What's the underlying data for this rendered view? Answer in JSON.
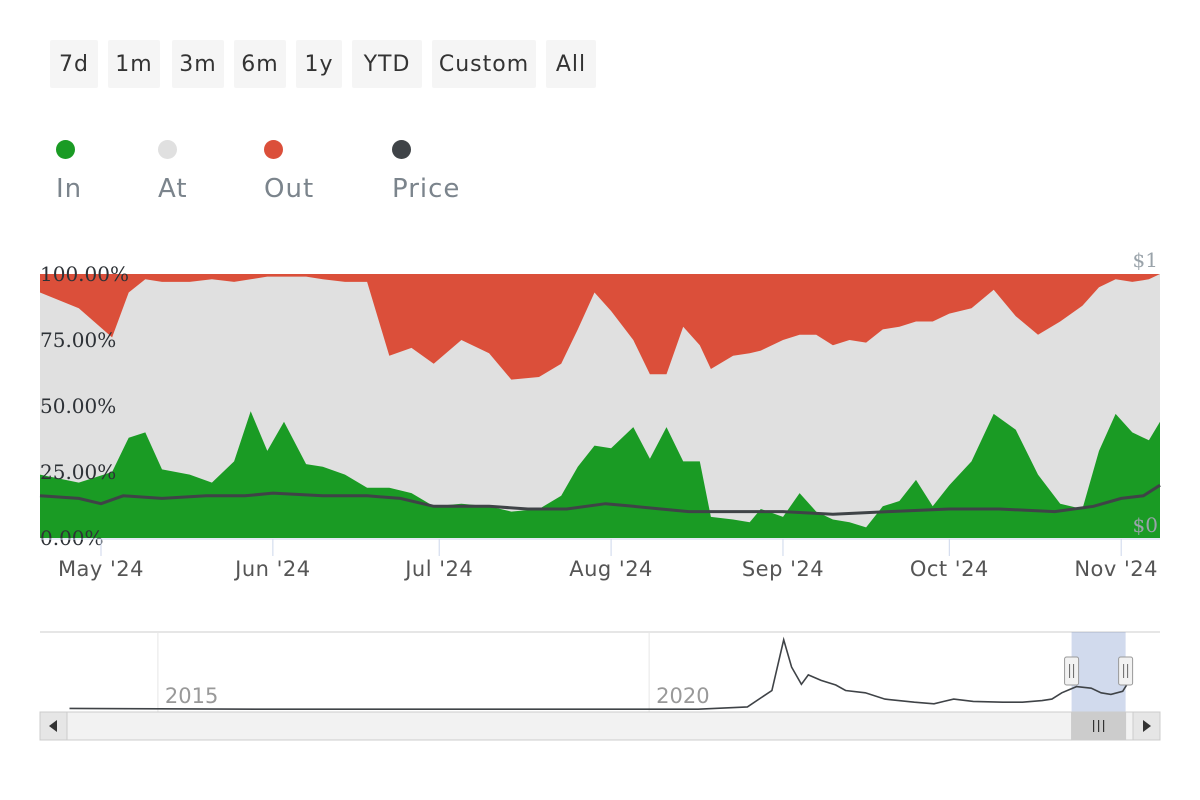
{
  "range_selector": {
    "buttons": [
      "7d",
      "1m",
      "3m",
      "6m",
      "1y",
      "YTD",
      "Custom",
      "All"
    ]
  },
  "legend": {
    "items": [
      {
        "label": "In",
        "color": "#1a9b24"
      },
      {
        "label": "At",
        "color": "#e0e0e0"
      },
      {
        "label": "Out",
        "color": "#db4f3a"
      },
      {
        "label": "Price",
        "color": "#3f4347"
      }
    ]
  },
  "chart_data": {
    "type": "area",
    "stacking": "percent",
    "title": "",
    "xlabel": "",
    "ylabel": "",
    "ylim": [
      0,
      100
    ],
    "y_ticks": [
      "0.00%",
      "25.00%",
      "50.00%",
      "75.00%",
      "100.00%"
    ],
    "price_axis": {
      "top_label": "$1",
      "bottom_label": "$0",
      "ylim": [
        0,
        1
      ]
    },
    "x_range": [
      "2024-04-20",
      "2024-11-08"
    ],
    "x_ticks": [
      {
        "date": "2024-05-01",
        "label": "May '24"
      },
      {
        "date": "2024-06-01",
        "label": "Jun '24"
      },
      {
        "date": "2024-07-01",
        "label": "Jul '24"
      },
      {
        "date": "2024-08-01",
        "label": "Aug '24"
      },
      {
        "date": "2024-09-01",
        "label": "Sep '24"
      },
      {
        "date": "2024-10-01",
        "label": "Oct '24"
      },
      {
        "date": "2024-11-01",
        "label": "Nov '24"
      }
    ],
    "series": [
      {
        "name": "In",
        "color": "#1a9b24",
        "points": [
          [
            "2024-04-20",
            24
          ],
          [
            "2024-04-27",
            21
          ],
          [
            "2024-05-03",
            25
          ],
          [
            "2024-05-06",
            38
          ],
          [
            "2024-05-09",
            40
          ],
          [
            "2024-05-12",
            26
          ],
          [
            "2024-05-17",
            24
          ],
          [
            "2024-05-21",
            21
          ],
          [
            "2024-05-25",
            29
          ],
          [
            "2024-05-28",
            48
          ],
          [
            "2024-05-31",
            33
          ],
          [
            "2024-06-03",
            44
          ],
          [
            "2024-06-07",
            28
          ],
          [
            "2024-06-10",
            27
          ],
          [
            "2024-06-14",
            24
          ],
          [
            "2024-06-18",
            19
          ],
          [
            "2024-06-22",
            19
          ],
          [
            "2024-06-26",
            17
          ],
          [
            "2024-06-30",
            12
          ],
          [
            "2024-07-05",
            13
          ],
          [
            "2024-07-10",
            12
          ],
          [
            "2024-07-14",
            10
          ],
          [
            "2024-07-19",
            11
          ],
          [
            "2024-07-23",
            16
          ],
          [
            "2024-07-26",
            27
          ],
          [
            "2024-07-29",
            35
          ],
          [
            "2024-08-01",
            34
          ],
          [
            "2024-08-05",
            42
          ],
          [
            "2024-08-08",
            30
          ],
          [
            "2024-08-11",
            42
          ],
          [
            "2024-08-14",
            29
          ],
          [
            "2024-08-17",
            29
          ],
          [
            "2024-08-19",
            8
          ],
          [
            "2024-08-23",
            7
          ],
          [
            "2024-08-26",
            6
          ],
          [
            "2024-08-28",
            11
          ],
          [
            "2024-09-01",
            8
          ],
          [
            "2024-09-04",
            17
          ],
          [
            "2024-09-07",
            10
          ],
          [
            "2024-09-10",
            7
          ],
          [
            "2024-09-13",
            6
          ],
          [
            "2024-09-16",
            4
          ],
          [
            "2024-09-19",
            12
          ],
          [
            "2024-09-22",
            14
          ],
          [
            "2024-09-25",
            22
          ],
          [
            "2024-09-28",
            12
          ],
          [
            "2024-10-01",
            20
          ],
          [
            "2024-10-05",
            29
          ],
          [
            "2024-10-09",
            47
          ],
          [
            "2024-10-13",
            41
          ],
          [
            "2024-10-17",
            24
          ],
          [
            "2024-10-21",
            13
          ],
          [
            "2024-10-25",
            11
          ],
          [
            "2024-10-28",
            33
          ],
          [
            "2024-10-31",
            47
          ],
          [
            "2024-11-03",
            40
          ],
          [
            "2024-11-06",
            37
          ],
          [
            "2024-11-08",
            44
          ]
        ]
      },
      {
        "name": "At",
        "color": "#e0e0e0",
        "points": [
          [
            "2024-04-20",
            69
          ],
          [
            "2024-04-27",
            66
          ],
          [
            "2024-05-03",
            51
          ],
          [
            "2024-05-06",
            55
          ],
          [
            "2024-05-09",
            58
          ],
          [
            "2024-05-12",
            71
          ],
          [
            "2024-05-17",
            73
          ],
          [
            "2024-05-21",
            77
          ],
          [
            "2024-05-25",
            68
          ],
          [
            "2024-05-28",
            50
          ],
          [
            "2024-05-31",
            66
          ],
          [
            "2024-06-03",
            55
          ],
          [
            "2024-06-07",
            71
          ],
          [
            "2024-06-10",
            71
          ],
          [
            "2024-06-14",
            73
          ],
          [
            "2024-06-18",
            78
          ],
          [
            "2024-06-22",
            50
          ],
          [
            "2024-06-26",
            55
          ],
          [
            "2024-06-30",
            54
          ],
          [
            "2024-07-05",
            62
          ],
          [
            "2024-07-10",
            58
          ],
          [
            "2024-07-14",
            50
          ],
          [
            "2024-07-19",
            50
          ],
          [
            "2024-07-23",
            50
          ],
          [
            "2024-07-26",
            52
          ],
          [
            "2024-07-29",
            58
          ],
          [
            "2024-08-01",
            52
          ],
          [
            "2024-08-05",
            33
          ],
          [
            "2024-08-08",
            32
          ],
          [
            "2024-08-11",
            20
          ],
          [
            "2024-08-14",
            51
          ],
          [
            "2024-08-17",
            44
          ],
          [
            "2024-08-19",
            56
          ],
          [
            "2024-08-23",
            62
          ],
          [
            "2024-08-26",
            64
          ],
          [
            "2024-08-28",
            60
          ],
          [
            "2024-09-01",
            67
          ],
          [
            "2024-09-04",
            60
          ],
          [
            "2024-09-07",
            67
          ],
          [
            "2024-09-10",
            66
          ],
          [
            "2024-09-13",
            69
          ],
          [
            "2024-09-16",
            70
          ],
          [
            "2024-09-19",
            67
          ],
          [
            "2024-09-22",
            66
          ],
          [
            "2024-09-25",
            60
          ],
          [
            "2024-09-28",
            70
          ],
          [
            "2024-10-01",
            65
          ],
          [
            "2024-10-05",
            58
          ],
          [
            "2024-10-09",
            47
          ],
          [
            "2024-10-13",
            43
          ],
          [
            "2024-10-17",
            53
          ],
          [
            "2024-10-21",
            69
          ],
          [
            "2024-10-25",
            77
          ],
          [
            "2024-10-28",
            62
          ],
          [
            "2024-10-31",
            51
          ],
          [
            "2024-11-03",
            57
          ],
          [
            "2024-11-06",
            61
          ],
          [
            "2024-11-08",
            56
          ]
        ]
      },
      {
        "name": "Out",
        "color": "#db4f3a",
        "points": [
          [
            "2024-04-20",
            7
          ],
          [
            "2024-04-27",
            13
          ],
          [
            "2024-05-03",
            24
          ],
          [
            "2024-05-06",
            7
          ],
          [
            "2024-05-09",
            2
          ],
          [
            "2024-05-12",
            3
          ],
          [
            "2024-05-17",
            3
          ],
          [
            "2024-05-21",
            2
          ],
          [
            "2024-05-25",
            3
          ],
          [
            "2024-05-28",
            2
          ],
          [
            "2024-05-31",
            1
          ],
          [
            "2024-06-03",
            1
          ],
          [
            "2024-06-07",
            1
          ],
          [
            "2024-06-10",
            2
          ],
          [
            "2024-06-14",
            3
          ],
          [
            "2024-06-18",
            3
          ],
          [
            "2024-06-22",
            31
          ],
          [
            "2024-06-26",
            28
          ],
          [
            "2024-06-30",
            34
          ],
          [
            "2024-07-05",
            25
          ],
          [
            "2024-07-10",
            30
          ],
          [
            "2024-07-14",
            40
          ],
          [
            "2024-07-19",
            39
          ],
          [
            "2024-07-23",
            34
          ],
          [
            "2024-07-26",
            21
          ],
          [
            "2024-07-29",
            7
          ],
          [
            "2024-08-01",
            14
          ],
          [
            "2024-08-05",
            25
          ],
          [
            "2024-08-08",
            38
          ],
          [
            "2024-08-11",
            38
          ],
          [
            "2024-08-14",
            20
          ],
          [
            "2024-08-17",
            27
          ],
          [
            "2024-08-19",
            36
          ],
          [
            "2024-08-23",
            31
          ],
          [
            "2024-08-26",
            30
          ],
          [
            "2024-08-28",
            29
          ],
          [
            "2024-09-01",
            25
          ],
          [
            "2024-09-04",
            23
          ],
          [
            "2024-09-07",
            23
          ],
          [
            "2024-09-10",
            27
          ],
          [
            "2024-09-13",
            25
          ],
          [
            "2024-09-16",
            26
          ],
          [
            "2024-09-19",
            21
          ],
          [
            "2024-09-22",
            20
          ],
          [
            "2024-09-25",
            18
          ],
          [
            "2024-09-28",
            18
          ],
          [
            "2024-10-01",
            15
          ],
          [
            "2024-10-05",
            13
          ],
          [
            "2024-10-09",
            6
          ],
          [
            "2024-10-13",
            16
          ],
          [
            "2024-10-17",
            23
          ],
          [
            "2024-10-21",
            18
          ],
          [
            "2024-10-25",
            12
          ],
          [
            "2024-10-28",
            5
          ],
          [
            "2024-10-31",
            2
          ],
          [
            "2024-11-03",
            3
          ],
          [
            "2024-11-06",
            2
          ],
          [
            "2024-11-08",
            0
          ]
        ]
      },
      {
        "name": "Price",
        "color": "#3f4347",
        "axis": "right",
        "points": [
          [
            "2024-04-20",
            0.16
          ],
          [
            "2024-04-27",
            0.15
          ],
          [
            "2024-05-01",
            0.13
          ],
          [
            "2024-05-05",
            0.16
          ],
          [
            "2024-05-12",
            0.15
          ],
          [
            "2024-05-20",
            0.16
          ],
          [
            "2024-05-27",
            0.16
          ],
          [
            "2024-06-01",
            0.17
          ],
          [
            "2024-06-10",
            0.16
          ],
          [
            "2024-06-18",
            0.16
          ],
          [
            "2024-06-24",
            0.15
          ],
          [
            "2024-06-30",
            0.12
          ],
          [
            "2024-07-10",
            0.12
          ],
          [
            "2024-07-17",
            0.11
          ],
          [
            "2024-07-24",
            0.11
          ],
          [
            "2024-07-31",
            0.13
          ],
          [
            "2024-08-05",
            0.12
          ],
          [
            "2024-08-10",
            0.11
          ],
          [
            "2024-08-15",
            0.1
          ],
          [
            "2024-08-25",
            0.1
          ],
          [
            "2024-09-01",
            0.1
          ],
          [
            "2024-09-10",
            0.09
          ],
          [
            "2024-09-20",
            0.1
          ],
          [
            "2024-10-01",
            0.11
          ],
          [
            "2024-10-10",
            0.11
          ],
          [
            "2024-10-20",
            0.1
          ],
          [
            "2024-10-27",
            0.12
          ],
          [
            "2024-11-01",
            0.15
          ],
          [
            "2024-11-05",
            0.16
          ],
          [
            "2024-11-08",
            0.2
          ]
        ]
      }
    ]
  },
  "navigator": {
    "year_labels": [
      {
        "year": 2015,
        "label": "2015"
      },
      {
        "year": 2020,
        "label": "2020"
      }
    ],
    "x_range": [
      2013.8,
      2025.2
    ],
    "window": [
      2024.3,
      2024.85
    ],
    "price_history": [
      [
        2014.1,
        0.02
      ],
      [
        2016.0,
        0.01
      ],
      [
        2018.0,
        0.01
      ],
      [
        2020.5,
        0.01
      ],
      [
        2021.0,
        0.04
      ],
      [
        2021.25,
        0.25
      ],
      [
        2021.37,
        0.9
      ],
      [
        2021.45,
        0.55
      ],
      [
        2021.55,
        0.33
      ],
      [
        2021.62,
        0.45
      ],
      [
        2021.75,
        0.38
      ],
      [
        2021.9,
        0.32
      ],
      [
        2022.0,
        0.25
      ],
      [
        2022.2,
        0.22
      ],
      [
        2022.4,
        0.14
      ],
      [
        2022.7,
        0.1
      ],
      [
        2022.9,
        0.08
      ],
      [
        2023.0,
        0.11
      ],
      [
        2023.1,
        0.14
      ],
      [
        2023.3,
        0.11
      ],
      [
        2023.6,
        0.1
      ],
      [
        2023.8,
        0.1
      ],
      [
        2024.0,
        0.12
      ],
      [
        2024.1,
        0.14
      ],
      [
        2024.2,
        0.22
      ],
      [
        2024.35,
        0.3
      ],
      [
        2024.5,
        0.28
      ],
      [
        2024.6,
        0.22
      ],
      [
        2024.7,
        0.2
      ],
      [
        2024.82,
        0.24
      ],
      [
        2024.9,
        0.4
      ]
    ]
  }
}
